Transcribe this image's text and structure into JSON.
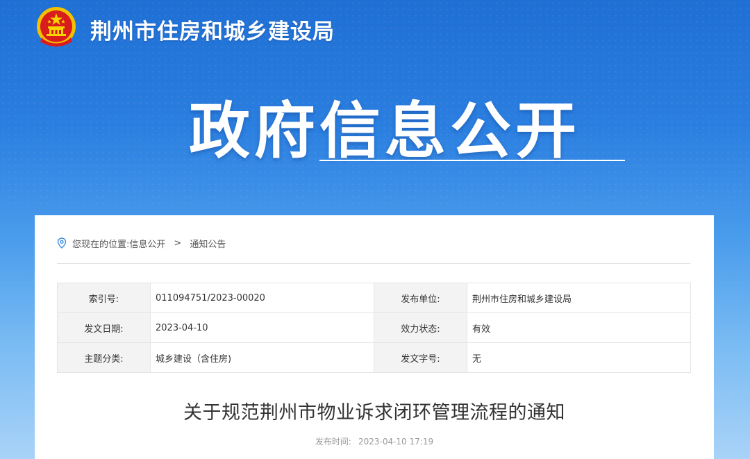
{
  "site": {
    "name": "荆州市住房和城乡建设局"
  },
  "banner": {
    "title": "政府信息公开"
  },
  "breadcrumb": {
    "prefix": "您现在的位置:",
    "items": [
      {
        "label": "信息公开"
      },
      {
        "label": "通知公告"
      }
    ],
    "separator": ">"
  },
  "meta": {
    "rows": [
      {
        "label1": "索引号:",
        "value1": "011094751/2023-00020",
        "label2": "发布单位:",
        "value2": "荆州市住房和城乡建设局"
      },
      {
        "label1": "发文日期:",
        "value1": "2023-04-10",
        "label2": "效力状态:",
        "value2": "有效"
      },
      {
        "label1": "主题分类:",
        "value1": "城乡建设（含住房)",
        "label2": "发文字号:",
        "value2": "无"
      }
    ]
  },
  "article": {
    "title": "关于规范荆州市物业诉求闭环管理流程的通知",
    "publish_label": "发布时间:",
    "publish_time": "2023-04-10 17:19"
  },
  "icons": {
    "emblem": "national-emblem-icon",
    "location": "location-pin-icon"
  },
  "colors": {
    "header_blue": "#1f6fd4",
    "light_blue": "#a9d3f8",
    "emblem_red": "#d91c1c",
    "emblem_gold": "#f5c400"
  }
}
